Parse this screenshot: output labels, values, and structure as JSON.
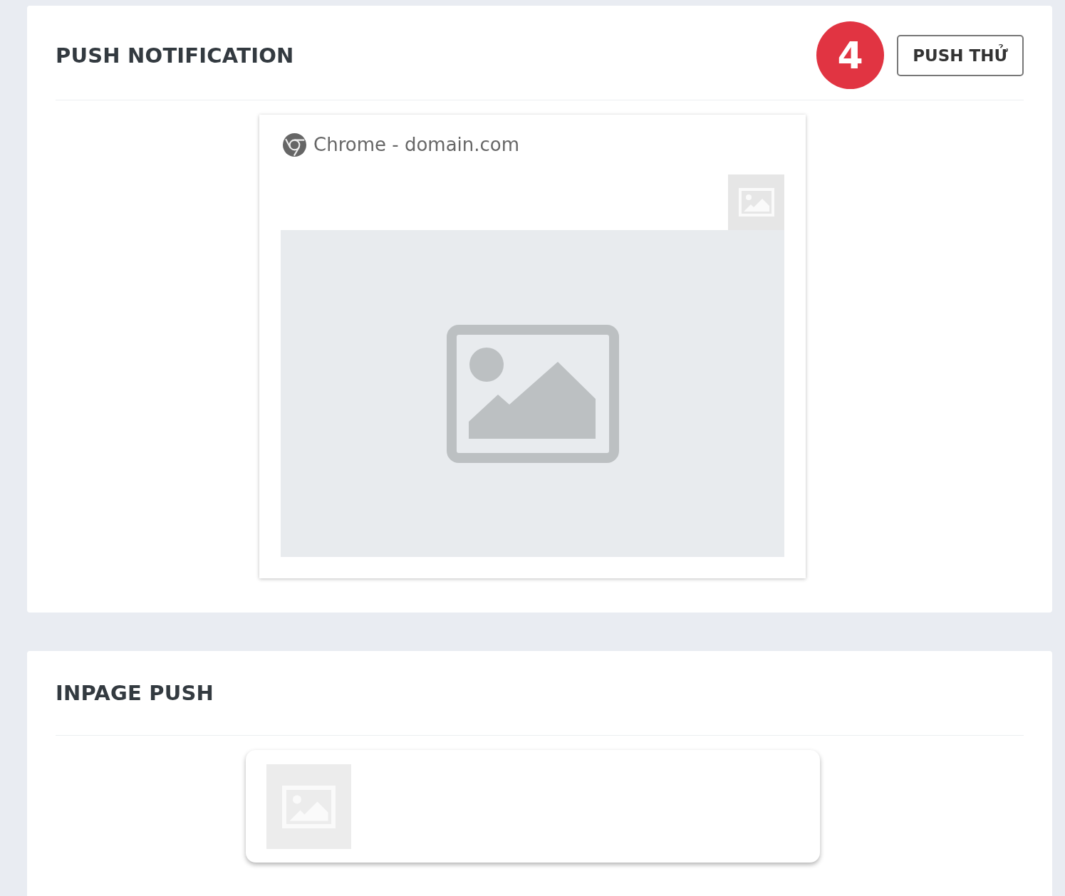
{
  "sections": [
    {
      "kind": "push",
      "title": "PUSH NOTIFICATION",
      "step_badge": "4",
      "button": "PUSH THỬ",
      "preview": {
        "source": "Chrome - domain.com"
      }
    },
    {
      "kind": "inpage",
      "title": "INPAGE PUSH"
    }
  ]
}
